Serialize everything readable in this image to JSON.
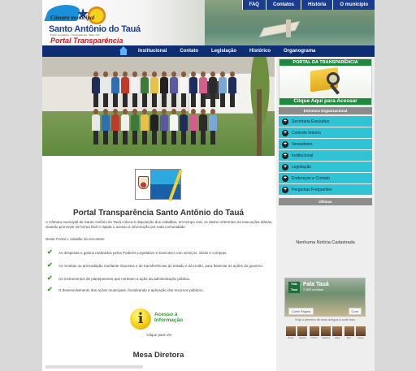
{
  "header": {
    "logo_camara": "Câmara municipal",
    "logo_city": "Santo Antônio do Tauá",
    "logo_subtitle": "Poder Legislativo - Transparência - Tauá - PA",
    "logo_portal": "Portal Transparência"
  },
  "topnav": [
    "FAQ",
    "Contatos",
    "História",
    "O município"
  ],
  "mainnav": [
    "Institucional",
    "Contato",
    "Legislação",
    "Histórico",
    "Organograma"
  ],
  "banner": {
    "top": "PORTAL DA TRANSPARÊNCIA",
    "bottom": "Clique Aqui para Acessar"
  },
  "sidebar": {
    "org_heading": "Estrutura Organizacional",
    "items": [
      "Secretaria Executiva",
      "Controle Interno",
      "Vereadores",
      "Institucional",
      "Legislação",
      "Endereços e Contato",
      "Perguntas Frequentes"
    ],
    "news_heading": "Últimas",
    "no_news": "Nenhuma Notícia Cadastrada"
  },
  "facebook": {
    "logo": "Fala Tauá",
    "name": "Fala Tauá",
    "count": "7.683 curtidas",
    "like_button": "Curtir Página",
    "share_button": "Com",
    "friends_text": "Seja o primeiro de seus amigos a curtir isso",
    "friend_names": [
      "Bruna",
      "Regina",
      "Ozemir",
      "Gutierres",
      "Erika",
      "Elvis",
      "Dayse"
    ]
  },
  "main": {
    "title": "Portal Transparência Santo Antônio do Tauá",
    "intro": "A Câmara municipal de Santo Antônio do Tauá coloca à disposição dos cidadãos, em tempo real, os dados referentes às execuções diárias, visando promover de forma fácil e rápida o acesso à informação por toda comunidade.",
    "intro2": "Neste Portal o cidadão irá encontrar:",
    "bullets": [
      "As despesas e gastos realizados pelos Poderes Legislativo e Executivo com serviços, obras e compras.",
      "As receitas ou arrecadação mediante impostos e de transferências do Estado e da União, para financiar as ações do governo.",
      "Os instrumentos de planejamento que norteiam a ação da administração pública.",
      "O desenvolvimento das ações municipais, fiscalizando a aplicação dos recursos públicos."
    ],
    "acesso_line1": "Acesso à",
    "acesso_line2": "Informação",
    "clique": "Clique para Ver",
    "mesa": "Mesa Diretora"
  },
  "colors": {
    "nav_blue": "#0d2e73",
    "top_nav_blue": "#1a3d8f",
    "sidebar_cyan": "#2ec4d6",
    "banner_green": "#1e8a3e",
    "portal_red": "#d01b1b"
  },
  "icons": [
    "home-icon",
    "plus-icon",
    "check-icon",
    "info-icon"
  ]
}
